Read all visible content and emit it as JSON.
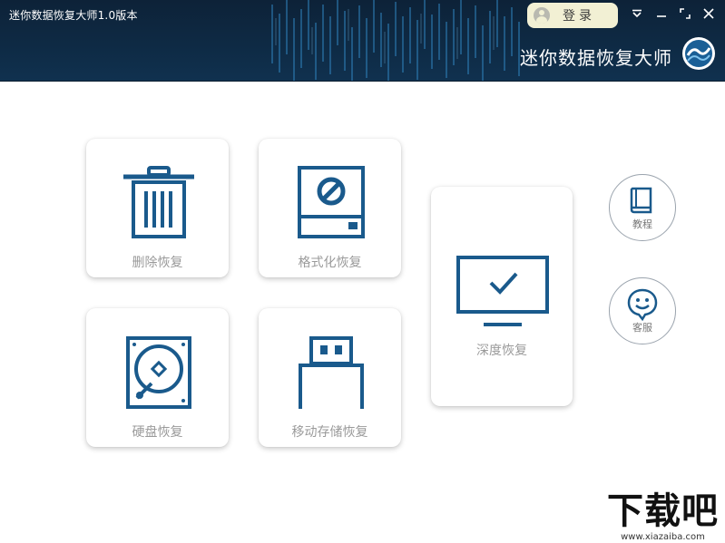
{
  "window": {
    "title": "迷你数据恢复大师1.0版本",
    "login_label": "登录",
    "brand_name": "迷你数据恢复大师",
    "controls": [
      "menu-icon",
      "minimize-icon",
      "maximize-icon",
      "close-icon"
    ]
  },
  "cards": {
    "delete": {
      "label": "删除恢复",
      "icon": "trash-icon"
    },
    "format": {
      "label": "格式化恢复",
      "icon": "format-icon"
    },
    "disk": {
      "label": "硬盘恢复",
      "icon": "hard-disk-icon"
    },
    "mobile": {
      "label": "移动存储恢复",
      "icon": "usb-drive-icon"
    },
    "deep": {
      "label": "深度恢复",
      "icon": "monitor-check-icon"
    }
  },
  "side": {
    "tutorial": {
      "label": "教程",
      "icon": "book-icon"
    },
    "service": {
      "label": "客服",
      "icon": "smiley-chat-icon"
    }
  },
  "watermark": {
    "text": "下载吧",
    "url": "www.xiazaiba.com"
  },
  "colors": {
    "header_bg": "#0e2a44",
    "accent_blue": "#1a5a8c",
    "label_gray": "#9a9a9a",
    "login_bg": "#f2f0d4"
  }
}
